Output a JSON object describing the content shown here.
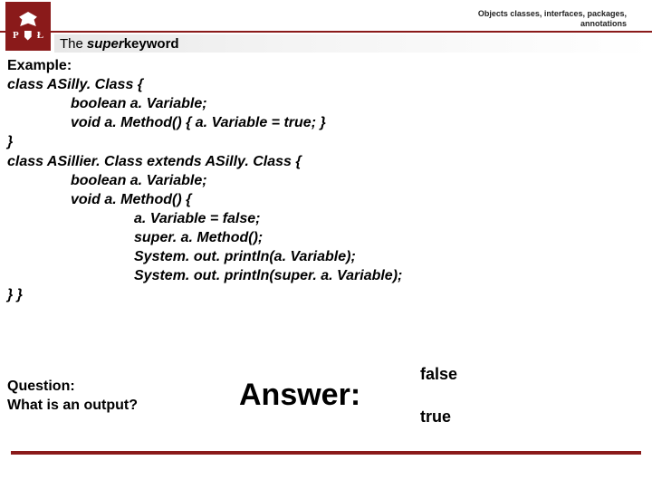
{
  "breadcrumb": {
    "line1": "Objects classes, interfaces, packages,",
    "line2": "annotations"
  },
  "logo": {
    "left": "P",
    "right": "Ł"
  },
  "title": {
    "pre": "The",
    "keyword": "super",
    "rest": " keyword"
  },
  "body": {
    "example_label": "Example:",
    "l1": "class ASilly. Class {",
    "l2": "boolean a. Variable;",
    "l3": "void a. Method() { a. Variable = true; }",
    "l4": "}",
    "l5": "class ASillier. Class extends ASilly. Class {",
    "l6": "boolean a. Variable;",
    "l7": "void a. Method() {",
    "l8": "a. Variable = false;",
    "l9": "super. a. Method();",
    "l10": "System. out. println(a. Variable);",
    "l11": "System. out. println(super. a. Variable);",
    "l12": "} }",
    "question_label": "Question:",
    "question_text": "What is an output?"
  },
  "answer": {
    "label": "Answer:",
    "a1": "false",
    "a2": "true"
  }
}
